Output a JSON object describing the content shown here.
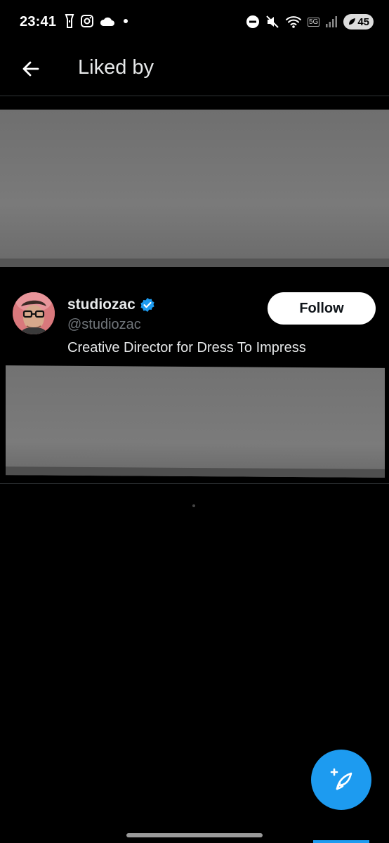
{
  "status_bar": {
    "time": "23:41",
    "left_icons": [
      "flashlight-icon",
      "instagram-icon",
      "cloud-icon",
      "dot-icon"
    ],
    "right_icons": [
      "do-not-disturb-icon",
      "mute-icon",
      "wifi-icon",
      "cellular-icon"
    ],
    "network_label": "5G",
    "battery_level": "45"
  },
  "header": {
    "title": "Liked by",
    "back_icon": "arrow-left-icon"
  },
  "users": [
    {
      "name": "studiozac",
      "handle": "@studiozac",
      "verified": true,
      "bio": "Creative Director for Dress To Impress",
      "follow_label": "Follow"
    }
  ],
  "fab": {
    "icon": "compose-feather-icon"
  },
  "colors": {
    "background": "#000000",
    "accent": "#1d9bf0",
    "secondary_text": "#71767b",
    "divider": "#2f3336",
    "redaction": "#777777"
  }
}
